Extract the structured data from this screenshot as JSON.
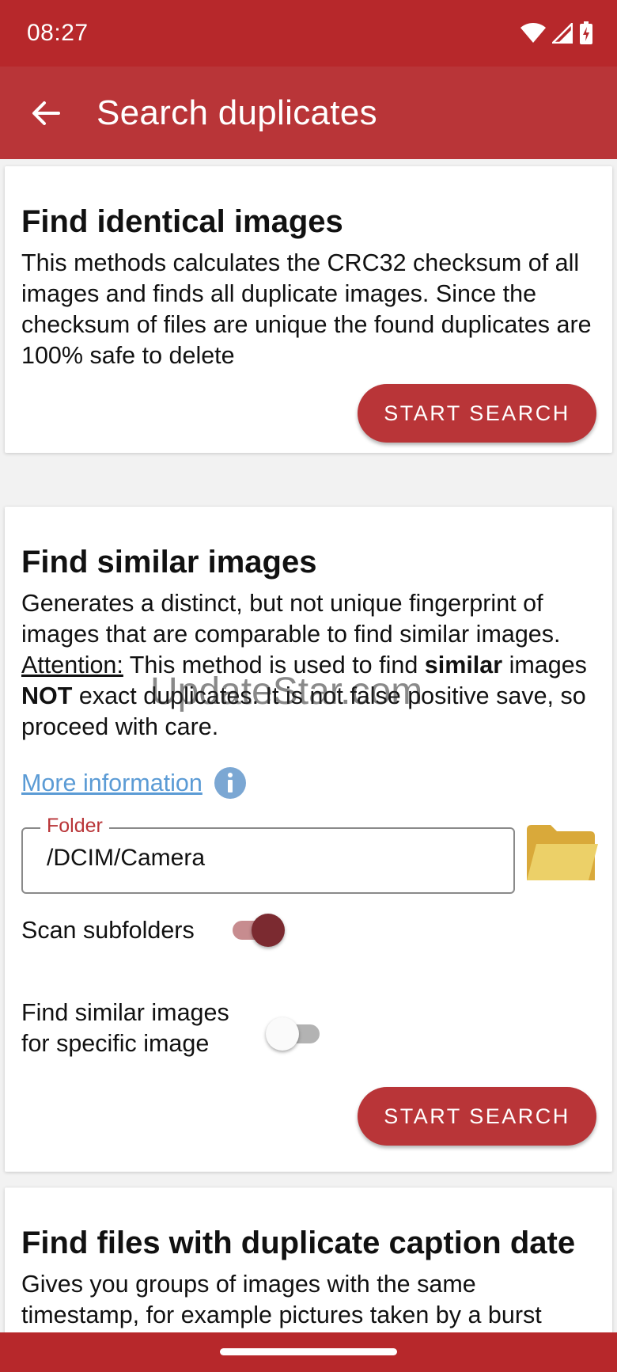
{
  "status_bar": {
    "time": "08:27"
  },
  "app_bar": {
    "title": "Search duplicates"
  },
  "cards": {
    "identical": {
      "title": "Find identical images",
      "description": "This methods calculates the CRC32 checksum of all images and finds all duplicate images. Since the checksum of files are unique the found duplicates are 100% safe to delete",
      "button": "START SEARCH"
    },
    "similar": {
      "title": "Find similar images",
      "desc_1": "Generates a distinct, but not unique fingerprint of images that are comparable to find similar images.  ",
      "desc_attention": "Attention:",
      "desc_2": " This method is used to find ",
      "desc_similar": "similar",
      "desc_3": " images ",
      "desc_not": "NOT",
      "desc_4": " exact duplicates. It is not false positive save, so proceed with care.",
      "more_info": "More information",
      "folder_label": "Folder",
      "folder_value": "/DCIM/Camera",
      "scan_subfolders": "Scan subfolders",
      "scan_subfolders_on": true,
      "specific_image": "Find similar images for specific image",
      "specific_image_on": false,
      "button": "START SEARCH"
    },
    "caption_date": {
      "title": "Find files with duplicate caption date",
      "description": "Gives you groups of images with the same timestamp, for example pictures taken by a burst"
    }
  },
  "watermark": "UpdateStar.com",
  "colors": {
    "primary": "#b93538",
    "status_bar": "#b7282b",
    "link": "#5b9bd5",
    "folder_icon": "#e8c34e",
    "switch_on_thumb": "#7b2a30",
    "switch_on_track": "#c78c8f"
  }
}
